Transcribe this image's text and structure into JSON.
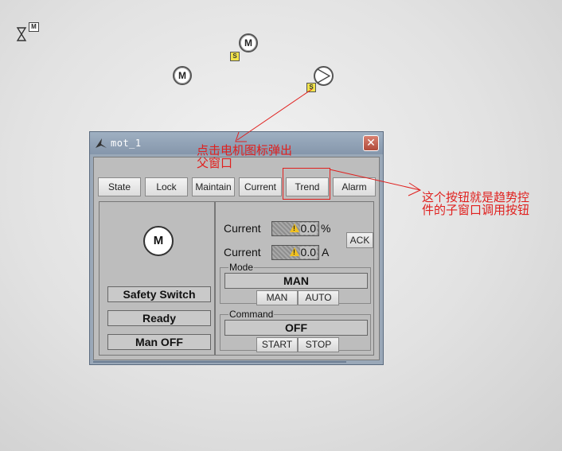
{
  "canvas": {
    "motor_label": "M",
    "safety_badge": "S",
    "hourglass_badge": "M"
  },
  "window": {
    "title": "mot_1",
    "close_glyph": "✕",
    "tabs": [
      "State",
      "Lock",
      "Maintain",
      "Current",
      "Trend",
      "Alarm"
    ],
    "motor_label": "M",
    "status": {
      "safety": "Safety Switch",
      "ready": "Ready",
      "man_off": "Man OFF"
    },
    "readings": [
      {
        "label": "Current",
        "value": "0.0",
        "unit": "%"
      },
      {
        "label": "Current",
        "value": "0.0",
        "unit": "A"
      }
    ],
    "ack_label": "ACK",
    "mode": {
      "legend": "Mode",
      "value": "MAN",
      "buttons": [
        "MAN",
        "AUTO"
      ]
    },
    "command": {
      "legend": "Command",
      "value": "OFF",
      "buttons": [
        "START",
        "STOP"
      ]
    }
  },
  "annotations": {
    "popup_note": "点击电机图标弹出\n父窗口",
    "trend_note": "这个按钮就是趋势控\n件的子窗口调用按钮",
    "color": "#e0201e"
  },
  "icons": [
    "hourglass-icon",
    "motor-icon",
    "valve-icon",
    "window-app-icon",
    "close-icon",
    "warning-icon",
    "arrow-icon"
  ]
}
